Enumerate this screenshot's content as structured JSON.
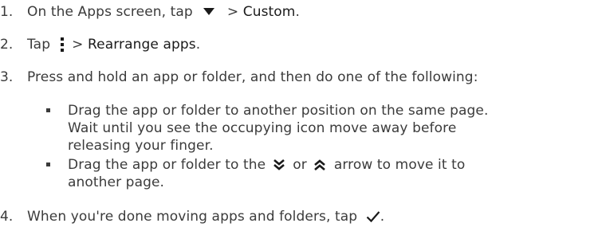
{
  "steps": [
    {
      "number": "1.",
      "text_before": "On the Apps screen, tap",
      "icon": "dropdown-triangle-icon",
      "text_between": ">",
      "bold_text": "Custom",
      "text_after": "."
    },
    {
      "number": "2.",
      "text_before": "Tap",
      "icon": "overflow-menu-icon",
      "text_between": ">",
      "bold_text": "Rearrange apps",
      "text_after": "."
    },
    {
      "number": "3.",
      "text": "Press and hold an app or folder, and then do one of the following:",
      "bullets": [
        {
          "line1": "Drag the app or folder to another position on the same page.",
          "line2": "Wait until you see the occupying icon move away before",
          "line3": "releasing your finger."
        },
        {
          "line1_before": "Drag the app or folder to the",
          "icon_down": "double-chevron-down-icon",
          "word_or": "or",
          "icon_up": "double-chevron-up-icon",
          "line1_after": "arrow to move it to",
          "line2": "another page."
        }
      ]
    },
    {
      "number": "4.",
      "text_before": "When you're done moving apps and folders, tap",
      "icon": "checkmark-icon",
      "text_after": "."
    }
  ]
}
